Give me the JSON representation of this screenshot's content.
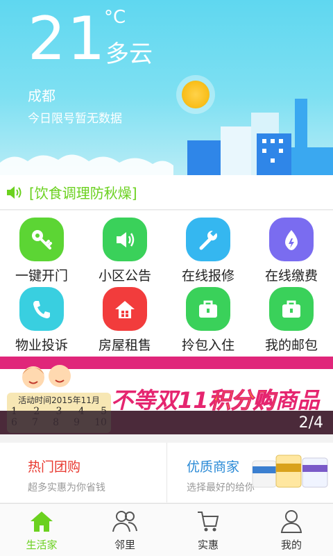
{
  "weather": {
    "temperature": "21",
    "unit": "°C",
    "condition": "多云",
    "city": "成都",
    "limit_info": "今日限号暂无数据"
  },
  "notice": {
    "text": "[饮食调理防秋燥]",
    "icon": "speaker-icon",
    "color": "#6bd11f"
  },
  "services": [
    {
      "label": "一键开门",
      "icon": "key-icon",
      "color": "#5cd534"
    },
    {
      "label": "小区公告",
      "icon": "speaker-icon",
      "color": "#3ad15a"
    },
    {
      "label": "在线报修",
      "icon": "wrench-icon",
      "color": "#35b7f0"
    },
    {
      "label": "在线缴费",
      "icon": "flame-drop-icon",
      "color": "#7a6cf0"
    },
    {
      "label": "物业投诉",
      "icon": "phone-icon",
      "color": "#39cfe0"
    },
    {
      "label": "房屋租售",
      "icon": "house-icon",
      "color": "#f23c3c"
    },
    {
      "label": "拎包入住",
      "icon": "bag-icon",
      "color": "#3ad15a"
    },
    {
      "label": "我的邮包",
      "icon": "bag-icon",
      "color": "#3ad15a"
    }
  ],
  "banner": {
    "calendar_title": "活动时间2015年11月",
    "calendar_row1": [
      "1",
      "2",
      "3",
      "4",
      "5"
    ],
    "calendar_row2": [
      "6",
      "7",
      "8",
      "9",
      "10"
    ],
    "slogan_prefix": "不等双11",
    "slogan_highlight": "积分购",
    "slogan_suffix": "商品",
    "pager": "2/4"
  },
  "merchants": [
    {
      "title": "热门团购",
      "subtitle": "超多实惠为你省钱",
      "title_color": "#e8382f"
    },
    {
      "title": "优质商家",
      "subtitle": "选择最好的给你",
      "title_color": "#2a8ad6"
    }
  ],
  "tabs": [
    {
      "label": "生活家",
      "icon": "home-icon",
      "active": true
    },
    {
      "label": "邻里",
      "icon": "people-icon",
      "active": false
    },
    {
      "label": "实惠",
      "icon": "cart-icon",
      "active": false
    },
    {
      "label": "我的",
      "icon": "person-icon",
      "active": false
    }
  ],
  "colors": {
    "accent": "#6bd11f",
    "banner_bg": "#e0267a",
    "sky": "#5fd7f0"
  }
}
